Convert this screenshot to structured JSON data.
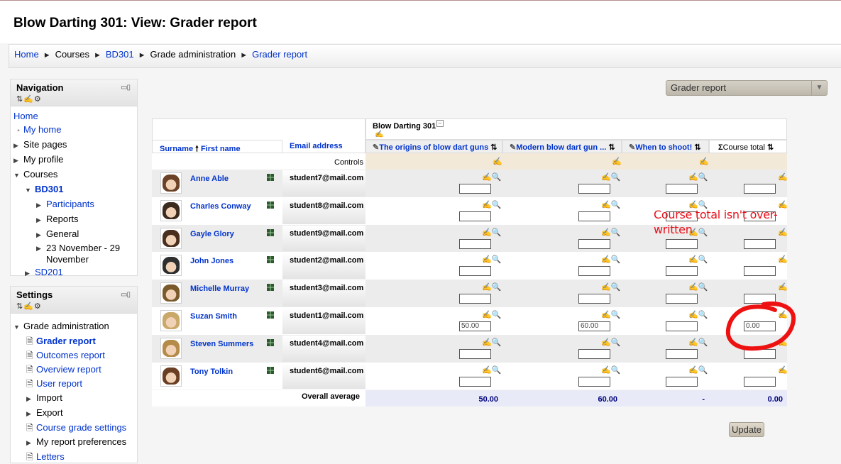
{
  "page": {
    "title": "Blow Darting 301: View: Grader report"
  },
  "breadcrumb": [
    {
      "label": "Home",
      "link": true
    },
    {
      "label": "Courses",
      "link": false
    },
    {
      "label": "BD301",
      "link": true
    },
    {
      "label": "Grade administration",
      "link": false
    },
    {
      "label": "Grader report",
      "link": true
    }
  ],
  "navigation_block": {
    "title": "Navigation",
    "items": {
      "home": "Home",
      "my_home": "My home",
      "site_pages": "Site pages",
      "my_profile": "My profile",
      "courses": "Courses",
      "bd301": "BD301",
      "participants": "Participants",
      "reports": "Reports",
      "general": "General",
      "week": "23 November - 29 November",
      "sd201": "SD201"
    }
  },
  "settings_block": {
    "title": "Settings",
    "items": {
      "grade_admin": "Grade administration",
      "grader_report": "Grader report",
      "outcomes_report": "Outcomes report",
      "overview_report": "Overview report",
      "user_report": "User report",
      "import": "Import",
      "export": "Export",
      "course_grade_settings": "Course grade settings",
      "my_report_preferences": "My report preferences",
      "letters": "Letters"
    }
  },
  "report_select": {
    "value": "Grader report"
  },
  "grader": {
    "category_header": "Blow Darting 301",
    "surname_label": "Surname",
    "firstname_label": "First name",
    "email_header": "Email address",
    "controls_label": "Controls",
    "items": [
      "The origins of blow dart guns",
      "Modern blow dart gun ...",
      "When to shoot!"
    ],
    "course_total_label": "Course total",
    "students": [
      {
        "name": "Anne Able",
        "email": "student7@mail.com",
        "grades": [
          "",
          "",
          "",
          ""
        ]
      },
      {
        "name": "Charles Conway",
        "email": "student8@mail.com",
        "grades": [
          "",
          "",
          "",
          ""
        ]
      },
      {
        "name": "Gayle Glory",
        "email": "student9@mail.com",
        "grades": [
          "",
          "",
          "",
          ""
        ]
      },
      {
        "name": "John Jones",
        "email": "student2@mail.com",
        "grades": [
          "",
          "",
          "",
          ""
        ]
      },
      {
        "name": "Michelle Murray",
        "email": "student3@mail.com",
        "grades": [
          "",
          "",
          "",
          ""
        ]
      },
      {
        "name": "Suzan Smith",
        "email": "student1@mail.com",
        "grades": [
          "50.00",
          "60.00",
          "",
          "0.00"
        ]
      },
      {
        "name": "Steven Summers",
        "email": "student4@mail.com",
        "grades": [
          "",
          "",
          "",
          ""
        ]
      },
      {
        "name": "Tony Tolkin",
        "email": "student6@mail.com",
        "grades": [
          "",
          "",
          "",
          ""
        ]
      }
    ],
    "overall_average_label": "Overall average",
    "averages": [
      "50.00",
      "60.00",
      "-",
      "0.00"
    ]
  },
  "annotation": {
    "text": "Course total isn't over-written"
  },
  "update_button": "Update",
  "colors": {
    "link": "#0033cc",
    "annotation": "#e8111b",
    "controls_row": "#f2e9d9",
    "average_row": "#e8ebf7"
  }
}
